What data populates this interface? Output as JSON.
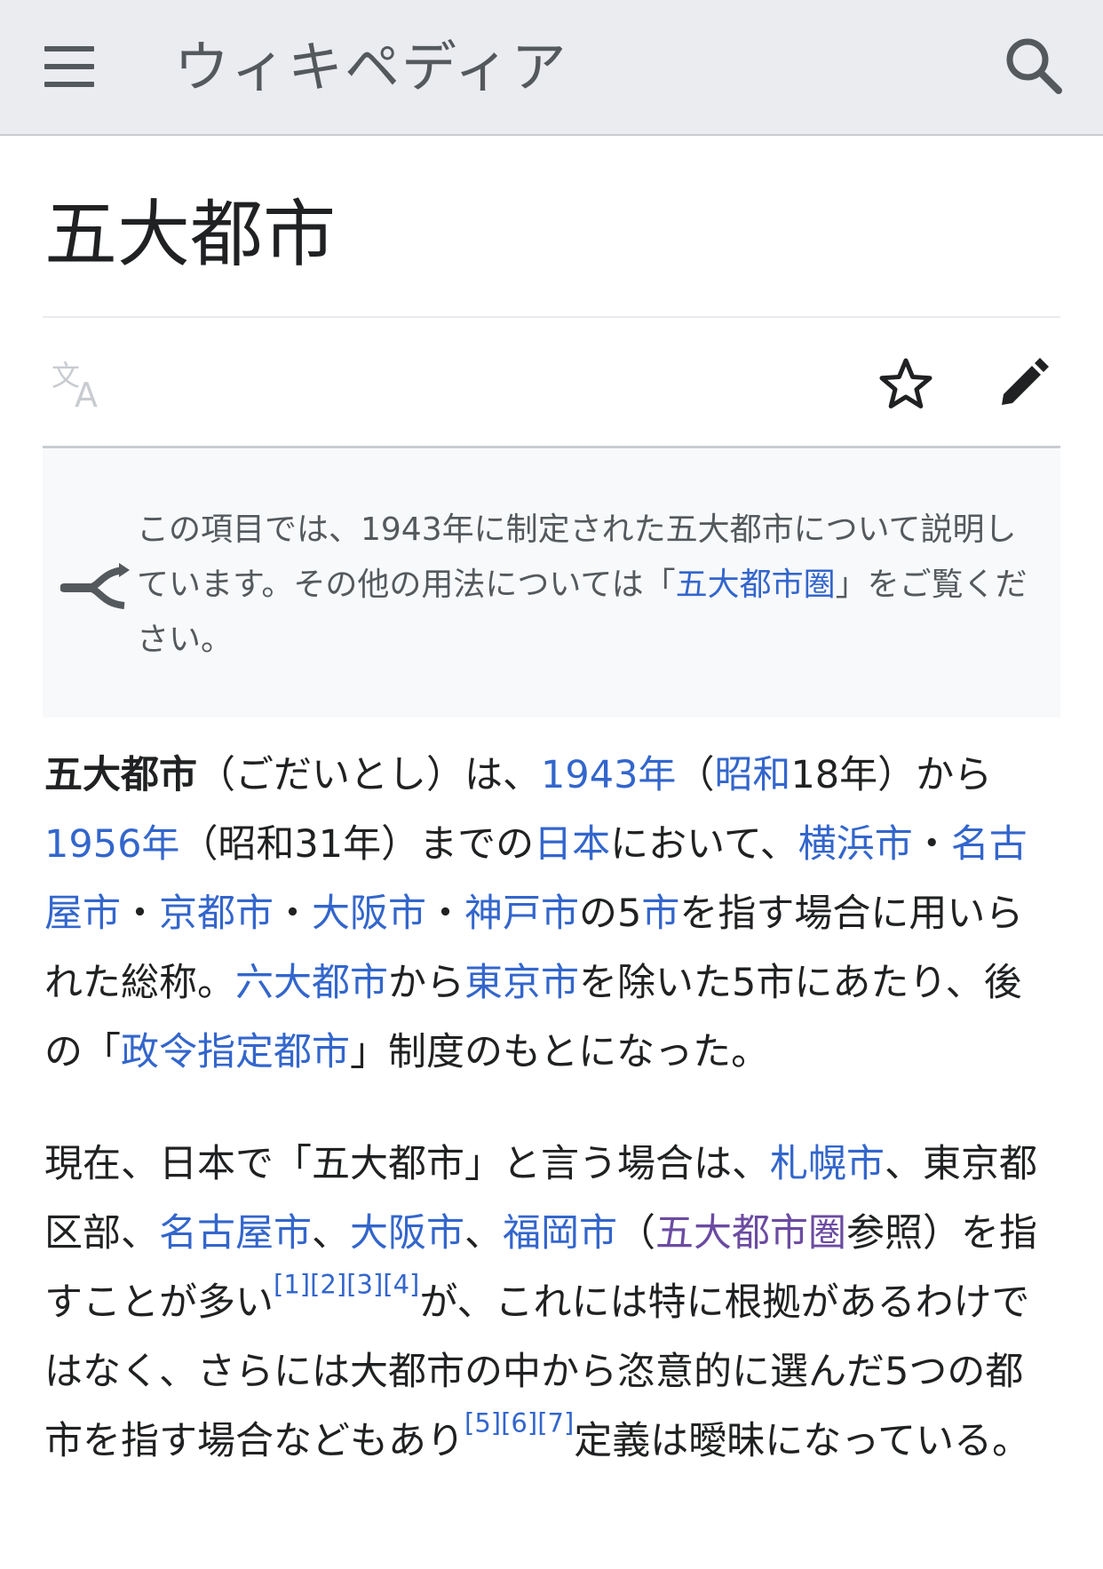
{
  "header": {
    "brand": "ウィキペディア",
    "icons": [
      "menu-icon",
      "search-icon"
    ]
  },
  "article": {
    "title": "五大都市",
    "actions": [
      "language-icon",
      "watch-star-icon",
      "edit-pencil-icon"
    ]
  },
  "hatnote": {
    "text_before": "この項目では、1943年に制定された五大都市について説明しています。その他の用法については「",
    "link": "五大都市圏",
    "text_after": "」をご覧ください。",
    "icon": "disambiguation-icon"
  },
  "para1": {
    "bold": "五大都市",
    "t1": "（ごだいとし）は、",
    "l_1943": "1943年",
    "t2": "（",
    "l_showa": "昭和",
    "t3": "18年）から",
    "l_1956": "1956年",
    "t4": "（昭和31年）までの",
    "l_japan": "日本",
    "t5": "において、",
    "l_yokohama": "横浜市",
    "sep1": "・",
    "l_nagoya": "名古屋市",
    "sep2": "・",
    "l_kyoto": "京都市",
    "sep3": "・",
    "l_osaka": "大阪市",
    "sep4": "・",
    "l_kobe": "神戸市",
    "t6": "の5",
    "l_shi": "市",
    "t7": "を指す場合に用いられた総称。",
    "l_six": "六大都市",
    "t8": "から",
    "l_tokyo": "東京市",
    "t9": "を除いた5市にあたり、後の「",
    "l_seirei": "政令指定都市",
    "t10": "」制度のもとになった。"
  },
  "para2": {
    "t1": "現在、日本で「五大都市」と言う場合は、",
    "l_sapporo": "札幌市",
    "t2": "、東京都区部、",
    "l_nagoya": "名古屋市",
    "t3": "、",
    "l_osaka": "大阪市",
    "t4": "、",
    "l_fukuoka": "福岡市",
    "t5": "（",
    "l_area": "五大都市圏",
    "t6": "参照）を指すことが多い",
    "ref1": "[1]",
    "ref2": "[2]",
    "ref3": "[3]",
    "ref4": "[4]",
    "t7": "が、これには特に根拠があるわけではなく、さらには大都市の中から恣意的に選んだ5つの都市を指す場合などもあり",
    "ref5": "[5]",
    "ref6": "[6]",
    "ref7": "[7]",
    "t8": "定義は曖昧になっている。"
  },
  "colors": {
    "link": "#3366cc",
    "visited_link": "#6b4ba1",
    "text": "#202122",
    "header_bg": "#eaecf0"
  }
}
